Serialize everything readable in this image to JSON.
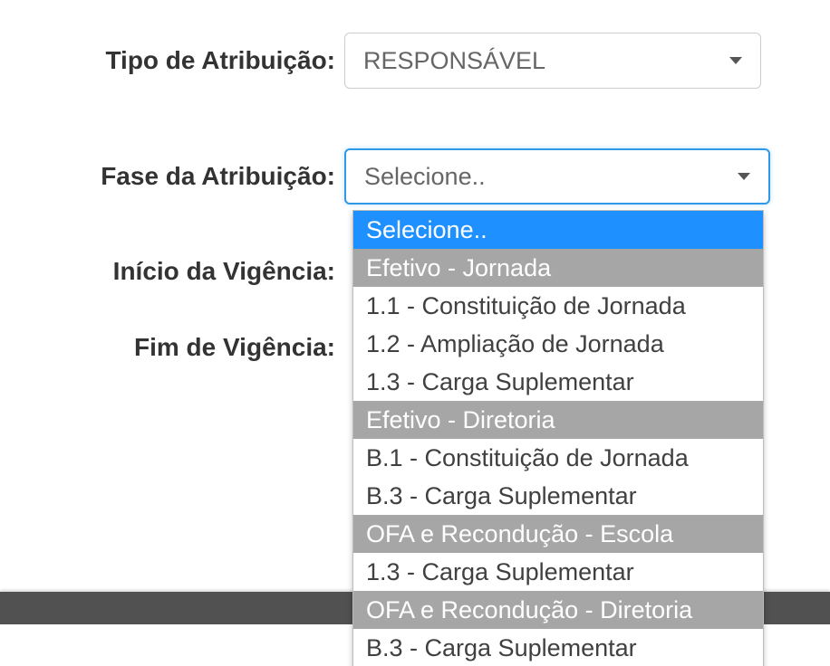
{
  "labels": {
    "tipo": "Tipo de Atribuição:",
    "fase": "Fase da Atribuição:",
    "inicio": "Início da Vigência:",
    "fim": "Fim de Vigência:"
  },
  "tipo_select": {
    "selected": "RESPONSÁVEL"
  },
  "fase_select": {
    "selected": "Selecione..",
    "options": [
      {
        "text": "Selecione..",
        "kind": "highlight"
      },
      {
        "text": "Efetivo - Jornada",
        "kind": "group"
      },
      {
        "text": "1.1 - Constituição de Jornada",
        "kind": "item"
      },
      {
        "text": "1.2 - Ampliação de Jornada",
        "kind": "item"
      },
      {
        "text": "1.3 - Carga Suplementar",
        "kind": "item"
      },
      {
        "text": "Efetivo - Diretoria",
        "kind": "group"
      },
      {
        "text": "B.1 - Constituição de Jornada",
        "kind": "item"
      },
      {
        "text": "B.3 - Carga Suplementar",
        "kind": "item"
      },
      {
        "text": "OFA e Recondução - Escola",
        "kind": "group"
      },
      {
        "text": "1.3 - Carga Suplementar",
        "kind": "item"
      },
      {
        "text": "OFA e Recondução - Diretoria",
        "kind": "group"
      },
      {
        "text": "B.3 - Carga Suplementar",
        "kind": "item"
      }
    ]
  }
}
